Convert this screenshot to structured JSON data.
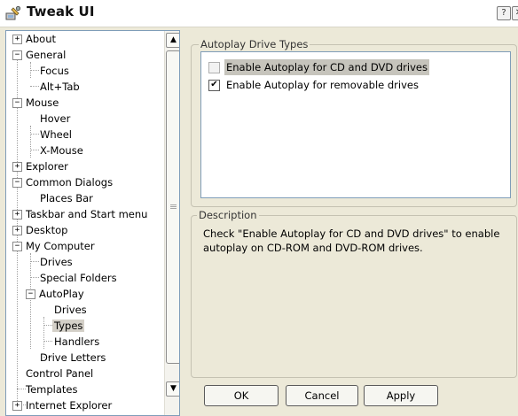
{
  "window": {
    "title": "Tweak UI",
    "help_glyph": "?",
    "close_glyph": "✕"
  },
  "tree": {
    "nodes": [
      {
        "label": "About",
        "expander": "+"
      },
      {
        "label": "General",
        "expander": "−"
      },
      {
        "label": "Focus"
      },
      {
        "label": "Alt+Tab"
      },
      {
        "label": "Mouse",
        "expander": "−"
      },
      {
        "label": "Hover"
      },
      {
        "label": "Wheel"
      },
      {
        "label": "X-Mouse"
      },
      {
        "label": "Explorer",
        "expander": "+"
      },
      {
        "label": "Common Dialogs",
        "expander": "−"
      },
      {
        "label": "Places Bar"
      },
      {
        "label": "Taskbar and Start menu",
        "expander": "+"
      },
      {
        "label": "Desktop",
        "expander": "+"
      },
      {
        "label": "My Computer",
        "expander": "−"
      },
      {
        "label": "Drives"
      },
      {
        "label": "Special Folders"
      },
      {
        "label": "AutoPlay",
        "expander": "−"
      },
      {
        "label": "Drives"
      },
      {
        "label": "Types",
        "selected": true
      },
      {
        "label": "Handlers"
      },
      {
        "label": "Drive Letters"
      },
      {
        "label": "Control Panel"
      },
      {
        "label": "Templates"
      },
      {
        "label": "Internet Explorer",
        "expander": "+"
      }
    ],
    "scroll_up": "▲",
    "scroll_down": "▼"
  },
  "autoplay": {
    "group_label": "Autoplay Drive Types",
    "items": [
      {
        "label": "Enable Autoplay for CD and DVD drives",
        "checked": false
      },
      {
        "label": "Enable Autoplay for removable drives",
        "checked": true
      }
    ]
  },
  "description": {
    "group_label": "Description",
    "text": "Check \"Enable Autoplay for CD and DVD drives\" to enable autoplay on CD-ROM and DVD-ROM drives."
  },
  "buttons": {
    "ok": "OK",
    "cancel": "Cancel",
    "apply": "Apply"
  }
}
